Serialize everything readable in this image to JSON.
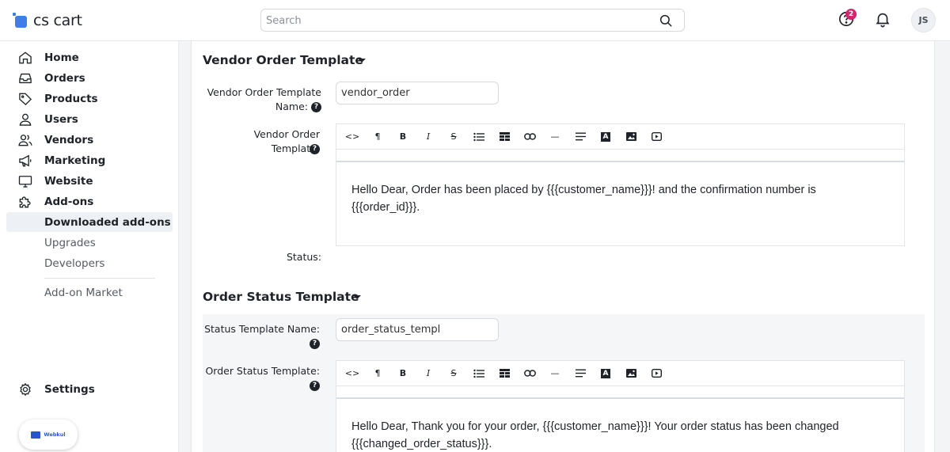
{
  "header": {
    "logo_text": "cs cart",
    "search_placeholder": "Search",
    "notification_count": "2",
    "avatar_initials": "JS"
  },
  "sidebar": {
    "items": [
      {
        "label": "Home",
        "icon": "home-icon"
      },
      {
        "label": "Orders",
        "icon": "inbox-icon"
      },
      {
        "label": "Products",
        "icon": "tag-icon"
      },
      {
        "label": "Users",
        "icon": "user-icon"
      },
      {
        "label": "Vendors",
        "icon": "users-icon"
      },
      {
        "label": "Marketing",
        "icon": "megaphone-icon"
      },
      {
        "label": "Website",
        "icon": "monitor-icon"
      },
      {
        "label": "Add-ons",
        "icon": "puzzle-icon"
      }
    ],
    "addons_sub": [
      "Downloaded add-ons",
      "Upgrades",
      "Developers"
    ],
    "addon_market": "Add-on Market",
    "settings": "Settings",
    "webkul": "Webkul"
  },
  "vendor_section": {
    "title": "Vendor Order Template",
    "name_label_line1": "Vendor Order Template",
    "name_label_line2": "Name:",
    "name_value": "vendor_order",
    "template_label": "Vendor Order Template:",
    "template_body_line1": "Hello Dear, Order has been placed by {{{customer_name}}}! and the confirmation number is",
    "template_body_line2": "{{{order_id}}}.",
    "status_label": "Status:"
  },
  "status_section": {
    "title": "Order Status Template",
    "name_label": "Status Template Name:",
    "name_value": "order_status_templ",
    "template_label": "Order Status Template:",
    "template_body_line1": "Hello Dear, Thank you for your order, {{{customer_name}}}! Your order status has been changed",
    "template_body_line2": "{{{changed_order_status}}}."
  },
  "toolbar": {
    "buttons": [
      "<>",
      "¶",
      "B",
      "I",
      "S",
      "bullet-list",
      "table",
      "link",
      "—",
      "align",
      "A",
      "image",
      "video"
    ]
  },
  "colors": {
    "accent": "#3d7fe6",
    "badge": "#d6246e",
    "webkul": "#2857c9"
  }
}
